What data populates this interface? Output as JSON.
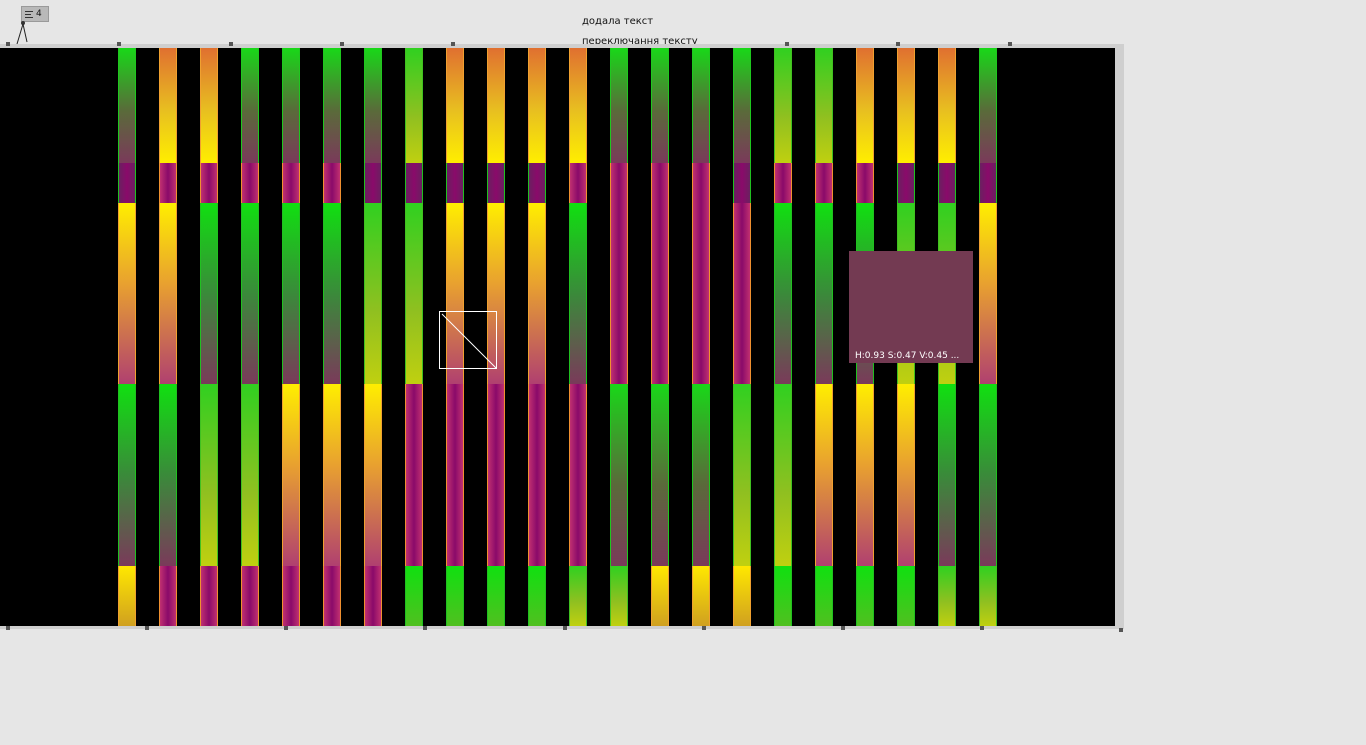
{
  "menu": {
    "icon": "menu-icon",
    "count": "4"
  },
  "captions": {
    "added_text": "додала текст",
    "switch_text": "переключання тексту"
  },
  "tooltip": {
    "values": "H:0.93  S:0.47  V:0.45  ...",
    "swatch_color": "#733a52"
  },
  "colors": {
    "canvas_background": "#000000",
    "page_background": "#e6e6e6"
  }
}
